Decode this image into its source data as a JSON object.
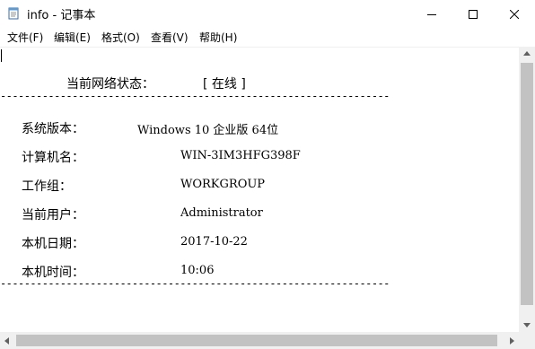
{
  "window": {
    "title": "info - 记事本"
  },
  "titlebar_buttons": {
    "minimize": "—",
    "maximize": "☐",
    "close": "✕"
  },
  "menu": {
    "items": [
      "文件(F)",
      "编辑(E)",
      "格式(O)",
      "查看(V)",
      "帮助(H)"
    ]
  },
  "content": {
    "network_label": "当前网络状态：",
    "network_status": "[ 在线 ]",
    "divider": "-----------------------------------------------------------------",
    "rows": [
      {
        "label": "系统版本：",
        "value": "Windows 10 企业版  64位"
      },
      {
        "label": "计算机名：",
        "value": "WIN-3IM3HFG398F"
      },
      {
        "label": "工作组：",
        "value": "WORKGROUP"
      },
      {
        "label": "当前用户：",
        "value": "Administrator"
      },
      {
        "label": "本机日期：",
        "value": "2017-10-22"
      },
      {
        "label": "本机时间：",
        "value": "10:06"
      }
    ]
  },
  "icons": {
    "app": "notepad-icon",
    "minimize": "minimize-icon",
    "maximize": "maximize-icon",
    "close": "close-icon"
  },
  "colors": {
    "scrollbar_track": "#f0f0f0",
    "scrollbar_thumb": "#c2c2c2"
  }
}
